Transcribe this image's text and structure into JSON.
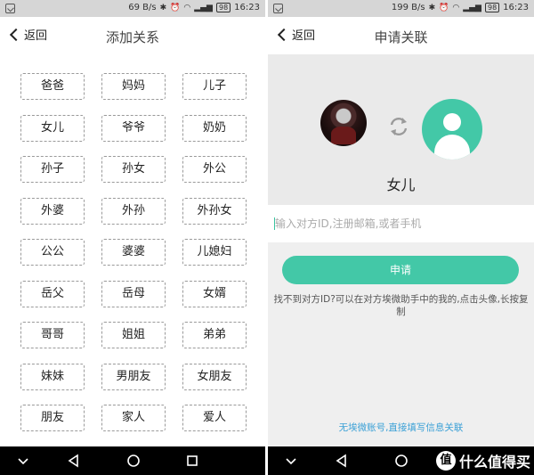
{
  "left": {
    "status": {
      "speed": "69 B/s",
      "battery": "98",
      "time": "16:23"
    },
    "nav": {
      "back_label": "返回",
      "title": "添加关系"
    },
    "relations": [
      "爸爸",
      "妈妈",
      "儿子",
      "女儿",
      "爷爷",
      "奶奶",
      "孙子",
      "孙女",
      "外公",
      "外婆",
      "外孙",
      "外孙女",
      "公公",
      "婆婆",
      "儿媳妇",
      "岳父",
      "岳母",
      "女婿",
      "哥哥",
      "姐姐",
      "弟弟",
      "妹妹",
      "男朋友",
      "女朋友",
      "朋友",
      "家人",
      "爱人"
    ]
  },
  "right": {
    "status": {
      "speed": "199 B/s",
      "battery": "98",
      "time": "16:23"
    },
    "nav": {
      "back_label": "返回",
      "title": "申请关联"
    },
    "relation_label": "女儿",
    "input": {
      "placeholder": "输入对方ID,注册邮箱,或者手机",
      "value": ""
    },
    "apply_label": "申请",
    "hint": "找不到对方ID?可以在对方埃微助手中的我的,点击头像,长按复制",
    "direct_link": "无埃微账号,直接填写信息关联"
  },
  "watermark": {
    "text": "什么值得买",
    "badge": "值"
  },
  "colors": {
    "accent": "#43c8a7",
    "link": "#3aa0d6",
    "statusbar": "#d6d6d6"
  },
  "icons": [
    "back-chevron-icon",
    "sync-icon",
    "default-avatar-icon",
    "nav-back-triangle-icon",
    "nav-home-circle-icon",
    "nav-recents-square-icon",
    "nav-collapse-chevron-icon"
  ]
}
